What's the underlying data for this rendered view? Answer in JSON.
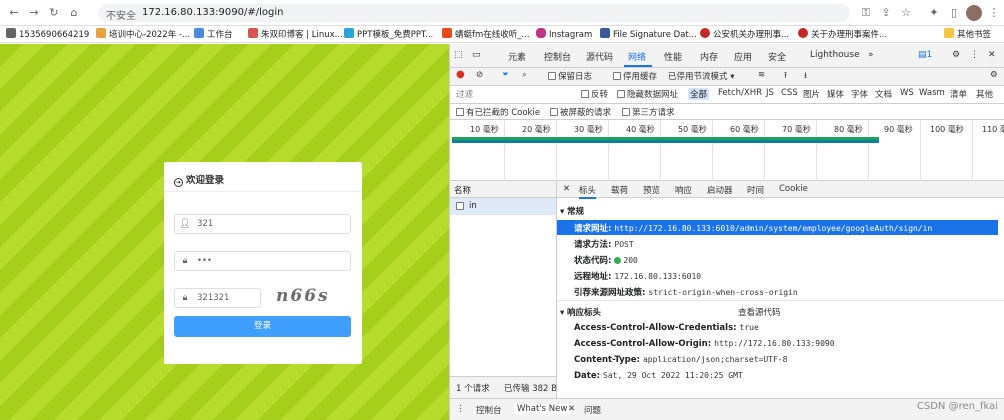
{
  "browser": {
    "url_insecure_label": "不安全",
    "url": "172.16.80.133:9090/#/login"
  },
  "bookmarks": [
    {
      "label": "1535690664219",
      "color": "#666666"
    },
    {
      "label": "培训中心-2022年 -...",
      "color": "#e8a33d"
    },
    {
      "label": "工作台",
      "color": "#4a89dc"
    },
    {
      "label": "朱双印博客 | Linux...",
      "color": "#d9534f"
    },
    {
      "label": "PPT模板_免费PPT...",
      "color": "#2aa5d8"
    },
    {
      "label": "蜻蜓fm在线收听_...",
      "color": "#e64a19"
    },
    {
      "label": "Instagram",
      "color": "#c13584"
    },
    {
      "label": "File Signature Dat...",
      "color": "#3b5998"
    },
    {
      "label": "公安机关办理刑事...",
      "color": "#c62828"
    },
    {
      "label": "关于办理刑事案件...",
      "color": "#c62828"
    },
    {
      "label": "其他书签",
      "color": "#f4c542"
    }
  ],
  "login": {
    "title": "欢迎登录",
    "username": "321",
    "password": "•••",
    "captcha_value": "321321",
    "captcha_image_text": "n66s",
    "submit_label": "登录"
  },
  "devtools": {
    "tabs": [
      "元素",
      "控制台",
      "源代码",
      "网络",
      "性能",
      "内存",
      "应用",
      "安全",
      "Lighthouse",
      "»"
    ],
    "active_tab": "网络",
    "issues_count": "1",
    "toolbar": {
      "preserve_log": "保留日志",
      "disable_cache": "停用缓存",
      "throttle": "已停用节流模式"
    },
    "filter": {
      "placeholder": "过滤",
      "invert": "反转",
      "hide_data_urls": "隐藏数据网址",
      "types": [
        "全部",
        "Fetch/XHR",
        "JS",
        "CSS",
        "图片",
        "媒体",
        "字体",
        "文档",
        "WS",
        "Wasm",
        "清单",
        "其他"
      ],
      "blocked_cookies": "有已拦截的 Cookie",
      "blocked_requests": "被屏蔽的请求",
      "third_party": "第三方请求"
    },
    "timeline_ticks": [
      "10 毫秒",
      "20 毫秒",
      "30 毫秒",
      "40 毫秒",
      "50 毫秒",
      "60 毫秒",
      "70 毫秒",
      "80 毫秒",
      "90 毫秒",
      "100 毫秒",
      "110 毫"
    ],
    "request_list": {
      "header": "名称",
      "rows": [
        "in"
      ],
      "footer_count": "1 个请求",
      "footer_transferred": "已传输 382 B"
    },
    "detail_tabs": [
      "标头",
      "载荷",
      "预览",
      "响应",
      "启动器",
      "时间",
      "Cookie"
    ],
    "general": {
      "title": "常规",
      "request_url_label": "请求网址:",
      "request_url": "http://172.16.80.133:6010/admin/system/employee/googleAuth/sign/in",
      "method_label": "请求方法:",
      "method": "POST",
      "status_label": "状态代码:",
      "status": "200",
      "remote_label": "远程地址:",
      "remote": "172.16.80.133:6010",
      "referrer_label": "引荐来源网址政策:",
      "referrer": "strict-origin-when-cross-origin"
    },
    "response_headers": {
      "title": "响应标头",
      "view_source": "查看源代码",
      "rows": [
        {
          "k": "Access-Control-Allow-Credentials:",
          "v": "true"
        },
        {
          "k": "Access-Control-Allow-Origin:",
          "v": "http://172.16.80.133:9090"
        },
        {
          "k": "Content-Type:",
          "v": "application/json;charset=UTF-8"
        },
        {
          "k": "Date:",
          "v": "Sat, 29 Oct 2022 11:20:25 GMT"
        }
      ]
    },
    "drawer_tabs": [
      "控制台",
      "What's New",
      "问题"
    ]
  },
  "watermark": "CSDN @ren_fkai"
}
